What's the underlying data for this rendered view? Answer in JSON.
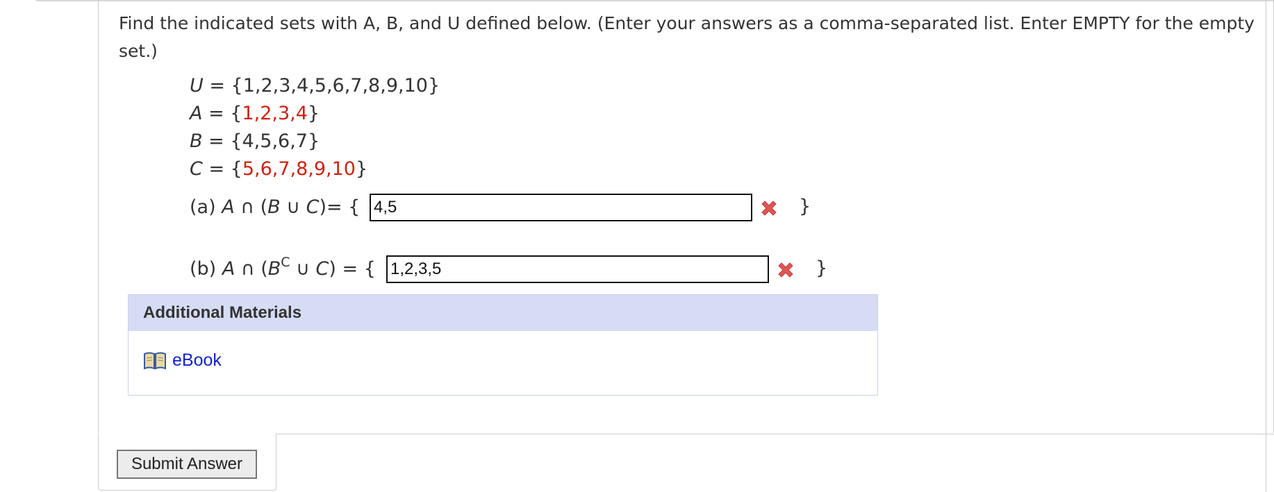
{
  "instructions": "Find the indicated sets with A, B, and U defined below. (Enter your answers as a comma-separated list. Enter EMPTY for the empty set.)",
  "sets": [
    {
      "name": "U",
      "eq": " = {",
      "value": "1,2,3,4,5,6,7,8,9,10",
      "close": "}",
      "highlight": false
    },
    {
      "name": "A",
      "eq": " = {",
      "value": "1,2,3,4",
      "close": "}",
      "highlight": true
    },
    {
      "name": "B",
      "eq": " = {",
      "value": "4,5,6,7",
      "close": "}",
      "highlight": false
    },
    {
      "name": "C",
      "eq": " = {",
      "value": "5,6,7,8,9,10",
      "close": "}",
      "highlight": true
    }
  ],
  "questions": [
    {
      "label": "(a)",
      "answer": "4,5",
      "status": "incorrect"
    },
    {
      "label": "(b)",
      "answer": "1,2,3,5",
      "status": "incorrect"
    }
  ],
  "additional_materials": {
    "header": "Additional Materials",
    "ebook_label": "eBook",
    "icon": "book-icon"
  },
  "submit_label": "Submit Answer",
  "colors": {
    "highlight": "#cc2211",
    "incorrect": "#e05555",
    "link": "#1122cc",
    "header_bg": "#d7dcf5"
  }
}
